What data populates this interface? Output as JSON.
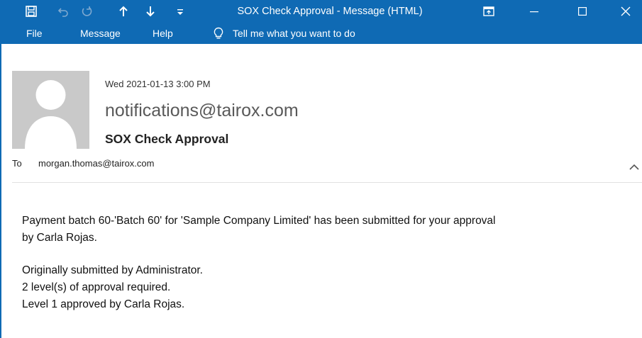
{
  "window": {
    "title": "SOX Check Approval  -  Message (HTML)"
  },
  "icons": {
    "save": "save-icon",
    "undo": "undo-icon",
    "redo": "redo-icon",
    "previous": "arrow-up-icon",
    "next": "arrow-down-icon",
    "customize": "customize-quick-access-icon",
    "ribbon_display": "ribbon-display-options-icon",
    "minimize": "minimize-icon",
    "maximize": "maximize-icon",
    "close": "close-icon",
    "tell_me": "lightbulb-icon",
    "avatar": "person-avatar-icon",
    "collapse": "chevron-up-icon"
  },
  "menu": {
    "items": [
      "File",
      "Message",
      "Help"
    ],
    "tell_me": "Tell me what you want to do"
  },
  "header": {
    "date": "Wed 2021-01-13 3:00 PM",
    "sender": "notifications@tairox.com",
    "subject": "SOX Check Approval",
    "to_label": "To",
    "to": "morgan.thomas@tairox.com"
  },
  "body": {
    "line1": "Payment batch 60-'Batch 60' for 'Sample Company Limited' has been submitted for your approval",
    "line2": "by Carla Rojas.",
    "line3": "Originally submitted by Administrator.",
    "line4": "2 level(s) of approval required.",
    "line5": "Level 1 approved by Carla Rojas."
  },
  "colors": {
    "accent": "#0f6ab4",
    "avatar_bg": "#c9c9c9"
  }
}
